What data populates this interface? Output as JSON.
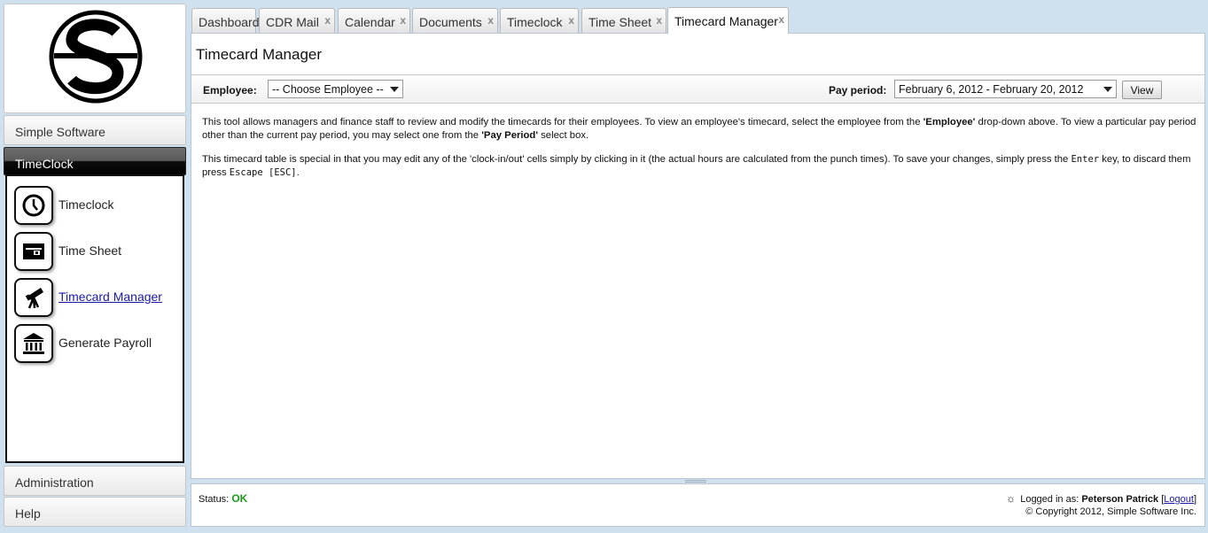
{
  "sidebar": {
    "sections": {
      "simple_software": "Simple Software",
      "timeclock": "TimeClock",
      "administration": "Administration",
      "help": "Help"
    },
    "items": [
      {
        "label": "Timeclock",
        "icon": "clock-icon"
      },
      {
        "label": "Time Sheet",
        "icon": "card-icon"
      },
      {
        "label": "Timecard Manager",
        "icon": "telescope-icon"
      },
      {
        "label": "Generate Payroll",
        "icon": "bank-icon"
      }
    ]
  },
  "tabs": [
    {
      "label": "Dashboard",
      "closable": false
    },
    {
      "label": "CDR Mail",
      "closable": true
    },
    {
      "label": "Calendar",
      "closable": true
    },
    {
      "label": "Documents",
      "closable": true
    },
    {
      "label": "Timeclock",
      "closable": true
    },
    {
      "label": "Time Sheet",
      "closable": true
    },
    {
      "label": "Timecard Manager",
      "closable": true,
      "active": true
    }
  ],
  "tab_close_glyph": "x",
  "main": {
    "title": "Timecard Manager",
    "employee_label": "Employee:",
    "employee_select": "-- Choose Employee --",
    "pay_period_label": "Pay period:",
    "pay_period_select": "February 6, 2012 - February 20, 2012",
    "view_button": "View",
    "desc1": {
      "a": "This tool allows managers and finance staff to review and modify the timecards for their employees. To view an employee's timecard, select the employee from the ",
      "b": "'Employee'",
      "c": " drop-down above. To view a particular pay period other than the current pay period, you may select one from the ",
      "d": "'Pay Period'",
      "e": " select box."
    },
    "desc2": {
      "a": "This timecard table is special in that you may edit any of the 'clock-in/out' cells simply by clicking in it (the actual hours are calculated from the punch times). To save your changes, simply press the ",
      "b": "Enter",
      "c": " key, to discard them press ",
      "d": "Escape [ESC]",
      "e": "."
    }
  },
  "status": {
    "label": "Status:",
    "value": "OK",
    "logged_in_label": "Logged in as:",
    "user": "Peterson Patrick",
    "bracket_open": "[",
    "logout": "Logout",
    "bracket_close": "]",
    "copyright": "© Copyright 2012, Simple Software Inc."
  },
  "colors": {
    "accent_link": "#1a1aa6",
    "status_ok": "#1c9a1c",
    "page_bg": "#cfe0ee"
  }
}
